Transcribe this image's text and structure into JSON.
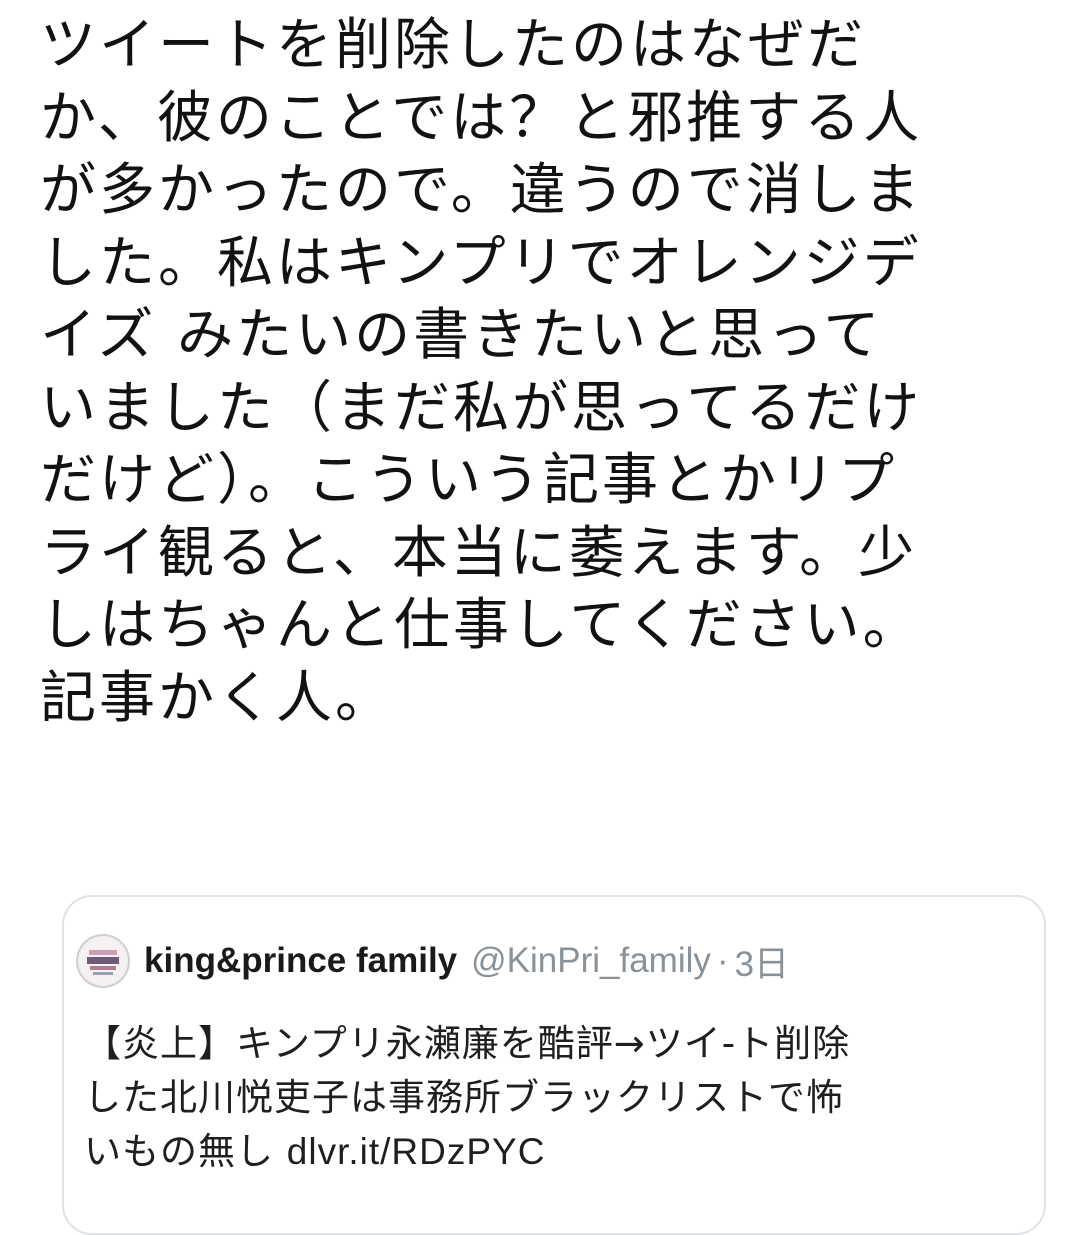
{
  "tweet": {
    "lines": [
      "ツイートを削除したのはなぜだ",
      "か、彼のことでは？と邪推する人",
      "が多かったので。違うので消しま",
      "した。私はキンプリでオレンジデ",
      "イズ みたいの書きたいと思って",
      "いました（まだ私が思ってるだけ",
      "だけど）。こういう記事とかリプ",
      "ライ観ると、本当に萎えます。少",
      "しはちゃんと仕事してください。",
      "記事かく人。"
    ]
  },
  "quote": {
    "avatar_icon": "avatar-logo-icon",
    "display_name": "king&prince family",
    "handle": "@KinPri_family",
    "separator": "·",
    "time": "3日",
    "body_lines": [
      "【炎上】キンプリ永瀬廉を酷評→ツイ-ト削除",
      "した北川悦吏子は事務所ブラックリストで怖"
    ],
    "last_line_text": "いもの無し ",
    "link": "dlvr.it/RDzPYC"
  },
  "colors": {
    "text": "#121212",
    "muted": "#8a9299",
    "border": "#dfe3e7"
  }
}
